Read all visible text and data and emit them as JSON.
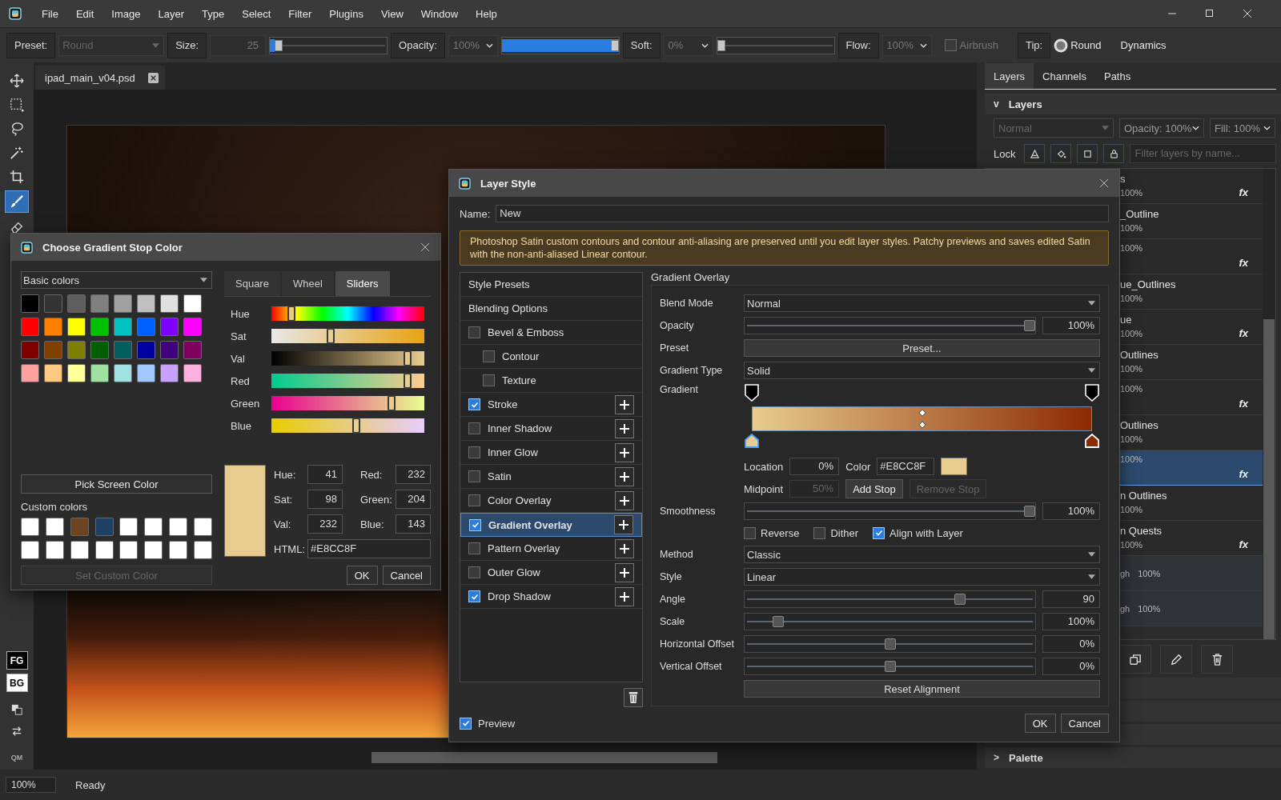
{
  "menu_bar": {
    "items": [
      "File",
      "Edit",
      "Image",
      "Layer",
      "Type",
      "Select",
      "Filter",
      "Plugins",
      "View",
      "Window",
      "Help"
    ]
  },
  "toolbar": {
    "items": [
      {
        "kind": "label",
        "text": "Preset:"
      },
      {
        "kind": "combo",
        "value": "Round"
      },
      {
        "kind": "label",
        "text": "Size:"
      },
      {
        "kind": "spin",
        "value": "25"
      },
      {
        "kind": "slider",
        "level": 0.04
      },
      {
        "kind": "label",
        "text": "Opacity:"
      },
      {
        "kind": "select",
        "value": "100%"
      },
      {
        "kind": "slider",
        "level": 1
      },
      {
        "kind": "label",
        "text": "Soft:"
      },
      {
        "kind": "select",
        "value": "0%"
      },
      {
        "kind": "slider",
        "level": 0
      },
      {
        "kind": "label",
        "text": "Flow:"
      },
      {
        "kind": "select",
        "value": "100%"
      },
      {
        "kind": "check",
        "text": "Airbrush",
        "checked": false
      },
      {
        "kind": "label",
        "text": "Tip:"
      },
      {
        "kind": "tip",
        "text": "Round"
      },
      {
        "kind": "button",
        "text": "Dynamics"
      }
    ]
  },
  "tools": [
    {
      "kind": "move",
      "selected": false
    },
    {
      "kind": "marquee",
      "selected": false
    },
    {
      "kind": "lasso",
      "selected": false
    },
    {
      "kind": "wand",
      "selected": false
    },
    {
      "kind": "crop",
      "selected": false
    },
    {
      "kind": "brush",
      "selected": true
    },
    {
      "kind": "eraser",
      "selected": false
    }
  ],
  "color_boxes": {
    "foreground": "FG",
    "background": "BG",
    "quick_mask": "QM"
  },
  "document_tabs": [
    {
      "title": "ipad_main_v04.psd"
    }
  ],
  "right_panel": {
    "tabs": [
      {
        "label": "Layers",
        "selected": true
      },
      {
        "label": "Channels",
        "selected": false
      },
      {
        "label": "Paths",
        "selected": false
      }
    ],
    "section": {
      "toggle": "v",
      "title": "Layers"
    },
    "blend_mode": "Normal",
    "opacity": "Opacity: 100%",
    "fill": "Fill: 100%",
    "lock_label": "Lock",
    "filter_placeholder": "Filter layers by name...",
    "layers": [
      {
        "kind": "layer",
        "name": "s",
        "opacity": "100%",
        "fx": "fx",
        "selected": false
      },
      {
        "kind": "layer",
        "name": "_Outline",
        "opacity": "100%",
        "selected": false
      },
      {
        "kind": "layer",
        "opacity": "100%",
        "fx": "fx",
        "selected": false
      },
      {
        "kind": "layer",
        "name": "ue_Outlines",
        "opacity": "100%",
        "selected": false
      },
      {
        "kind": "layer",
        "name": "ue",
        "opacity": "100%",
        "fx": "fx",
        "selected": false
      },
      {
        "kind": "layer",
        "name": "Outlines",
        "opacity": "100%",
        "selected": false
      },
      {
        "kind": "layer",
        "opacity": "100%",
        "fx": "fx",
        "selected": false
      },
      {
        "kind": "layer",
        "name": "Outlines",
        "opacity": "100%",
        "selected": false
      },
      {
        "kind": "layer",
        "opacity": "100%",
        "fx": "fx",
        "selected": true
      },
      {
        "kind": "layer",
        "name": "n Outlines",
        "opacity": "100%",
        "selected": false
      },
      {
        "kind": "layer",
        "name": "n Quests",
        "opacity": "100%",
        "fx": "fx",
        "selected": false
      },
      {
        "kind": "adjustment",
        "name": "gh",
        "opacity": "100%",
        "selected": false
      },
      {
        "kind": "adjustment",
        "name": "gh",
        "opacity": "100%",
        "selected": false
      }
    ],
    "collapsed_sections": [
      {
        "toggle": ">",
        "title": "Palette"
      }
    ]
  },
  "status_bar": {
    "zoom": "100%",
    "message": "Ready"
  },
  "color_dialog": {
    "title": "Choose Gradient Stop Color",
    "palette": "Basic colors",
    "basic_colors": [
      {
        "color": "#000000"
      },
      {
        "color": "#333333"
      },
      {
        "color": "#5e5e5e"
      },
      {
        "color": "#808080"
      },
      {
        "color": "#a0a0a0"
      },
      {
        "color": "#c0c0c0"
      },
      {
        "color": "#e0e0e0"
      },
      {
        "color": "#ffffff"
      },
      {
        "color": "#ff0000"
      },
      {
        "color": "#ff8000"
      },
      {
        "color": "#ffff00"
      },
      {
        "color": "#00c000"
      },
      {
        "color": "#00c0c0"
      },
      {
        "color": "#0060ff"
      },
      {
        "color": "#8000ff"
      },
      {
        "color": "#ff00ff"
      },
      {
        "color": "#800000"
      },
      {
        "color": "#804000"
      },
      {
        "color": "#808000"
      },
      {
        "color": "#006000"
      },
      {
        "color": "#006060"
      },
      {
        "color": "#0000a0"
      },
      {
        "color": "#400080"
      },
      {
        "color": "#800060"
      },
      {
        "color": "#ffa0a0"
      },
      {
        "color": "#ffc880"
      },
      {
        "color": "#ffff99"
      },
      {
        "color": "#a0e0a0"
      },
      {
        "color": "#a0e0e0"
      },
      {
        "color": "#a0c8ff"
      },
      {
        "color": "#c8a0ff"
      },
      {
        "color": "#ffb0e0"
      }
    ],
    "pick_button": "Pick Screen Color",
    "custom_label": "Custom colors",
    "custom_colors": [
      {
        "color": "#ffffff"
      },
      {
        "color": "#ffffff"
      },
      {
        "color": "#6b4423"
      },
      {
        "color": "#1f4063"
      },
      {
        "color": "#ffffff"
      },
      {
        "color": "#ffffff"
      },
      {
        "color": "#ffffff"
      },
      {
        "color": "#ffffff"
      },
      {
        "color": "#ffffff"
      },
      {
        "color": "#ffffff"
      },
      {
        "color": "#ffffff"
      },
      {
        "color": "#ffffff"
      },
      {
        "color": "#ffffff"
      },
      {
        "color": "#ffffff"
      },
      {
        "color": "#ffffff"
      },
      {
        "color": "#ffffff"
      }
    ],
    "set_custom_button": "Set Custom Color",
    "tabs": [
      {
        "label": "Square",
        "selected": false
      },
      {
        "label": "Wheel",
        "selected": false
      },
      {
        "label": "Sliders",
        "selected": true
      }
    ],
    "sliders": [
      {
        "kind": "hue",
        "label": "Hue",
        "level": 0.11
      },
      {
        "kind": "sat",
        "label": "Sat",
        "level": 0.38
      },
      {
        "kind": "val",
        "label": "Val",
        "level": 0.91
      },
      {
        "kind": "red",
        "label": "Red",
        "level": 0.91
      },
      {
        "kind": "green",
        "label": "Green",
        "level": 0.8
      },
      {
        "kind": "blue",
        "label": "Blue",
        "level": 0.56
      }
    ],
    "current": {
      "color": "#e8cc8f"
    },
    "fields": [
      {
        "label": "Hue:",
        "value": "41"
      },
      {
        "label": "Red:",
        "value": "232"
      },
      {
        "label": "Sat:",
        "value": "98"
      },
      {
        "label": "Green:",
        "value": "204"
      },
      {
        "label": "Val:",
        "value": "232"
      },
      {
        "label": "Blue:",
        "value": "143"
      }
    ],
    "html_label": "HTML:",
    "html_value": "#E8CC8F",
    "ok": "OK",
    "cancel": "Cancel"
  },
  "layer_style": {
    "title": "Layer Style",
    "name_label": "Name:",
    "name": "New",
    "warning": "Photoshop Satin custom contours and contour anti-aliasing are preserved until you edit layer styles. Patchy previews and saves edited Satin with the non-anti-aliased Linear contour.",
    "styles": [
      {
        "kind": "header",
        "label": "Style Presets",
        "selected": false
      },
      {
        "kind": "header",
        "label": "Blending Options",
        "selected": false
      },
      {
        "kind": "effect",
        "label": "Bevel & Emboss",
        "checked": false,
        "add": false,
        "selected": false
      },
      {
        "kind": "sub",
        "label": "Contour",
        "checked": false,
        "selected": false
      },
      {
        "kind": "sub",
        "label": "Texture",
        "checked": false,
        "selected": false
      },
      {
        "kind": "effect",
        "label": "Stroke",
        "checked": true,
        "add": true,
        "selected": false
      },
      {
        "kind": "effect",
        "label": "Inner Shadow",
        "checked": false,
        "add": true,
        "selected": false
      },
      {
        "kind": "effect",
        "label": "Inner Glow",
        "checked": false,
        "add": true,
        "selected": false
      },
      {
        "kind": "effect",
        "label": "Satin",
        "checked": false,
        "add": true,
        "selected": false
      },
      {
        "kind": "effect",
        "label": "Color Overlay",
        "checked": false,
        "add": true,
        "selected": false
      },
      {
        "kind": "effect",
        "label": "Gradient Overlay",
        "checked": true,
        "add": true,
        "selected": true
      },
      {
        "kind": "effect",
        "label": "Pattern Overlay",
        "checked": false,
        "add": true,
        "selected": false
      },
      {
        "kind": "effect",
        "label": "Outer Glow",
        "checked": false,
        "add": true,
        "selected": false
      },
      {
        "kind": "effect",
        "label": "Drop Shadow",
        "checked": true,
        "add": true,
        "selected": false
      }
    ],
    "group_title": "Gradient Overlay",
    "rows": [
      {
        "kind": "select",
        "label": "Blend Mode",
        "value": "Normal"
      },
      {
        "kind": "slider",
        "label": "Opacity",
        "level": 1,
        "value": "100%"
      },
      {
        "kind": "button",
        "label": "Preset",
        "text": "Preset..."
      },
      {
        "kind": "select",
        "label": "Gradient Type",
        "value": "Solid"
      },
      {
        "kind": "gradient",
        "label": "Gradient",
        "opacity_stops": [
          {
            "selected": false
          },
          {
            "selected": false
          }
        ],
        "color_stops": [
          {
            "color": "#e8cc8f",
            "selected": true
          },
          {
            "color": "#8c2a02",
            "selected": false
          }
        ]
      },
      {
        "kind": "stop",
        "location_label": "Location",
        "location": "0%",
        "color_label": "Color",
        "color_value": "#E8CC8F",
        "color": "#e8cc8f"
      },
      {
        "kind": "midpoint",
        "midpoint_label": "Midpoint",
        "midpoint": {
          "value": "50%",
          "disabled": true
        },
        "buttons": [
          {
            "text": "Add Stop",
            "disabled": false
          },
          {
            "text": "Remove Stop",
            "disabled": true
          }
        ]
      },
      {
        "kind": "slider",
        "label": "Smoothness",
        "level": 1,
        "value": "100%"
      },
      {
        "kind": "checks",
        "items": [
          {
            "label": "Reverse",
            "checked": false
          },
          {
            "label": "Dither",
            "checked": false
          },
          {
            "label": "Align with Layer",
            "checked": true
          }
        ]
      },
      {
        "kind": "select",
        "label": "Method",
        "value": "Classic"
      },
      {
        "kind": "select",
        "label": "Style",
        "value": "Linear"
      },
      {
        "kind": "slider",
        "label": "Angle",
        "level": 0.75,
        "value": "90"
      },
      {
        "kind": "slider",
        "label": "Scale",
        "level": 0.1,
        "value": "100%"
      },
      {
        "kind": "slider",
        "label": "Horizontal Offset",
        "level": 0.5,
        "value": "0%"
      },
      {
        "kind": "slider",
        "label": "Vertical Offset",
        "level": 0.5,
        "value": "0%"
      },
      {
        "kind": "button",
        "text": "Reset Alignment"
      }
    ],
    "preview": {
      "label": "Preview",
      "checked": true
    },
    "ok": "OK",
    "cancel": "Cancel"
  }
}
